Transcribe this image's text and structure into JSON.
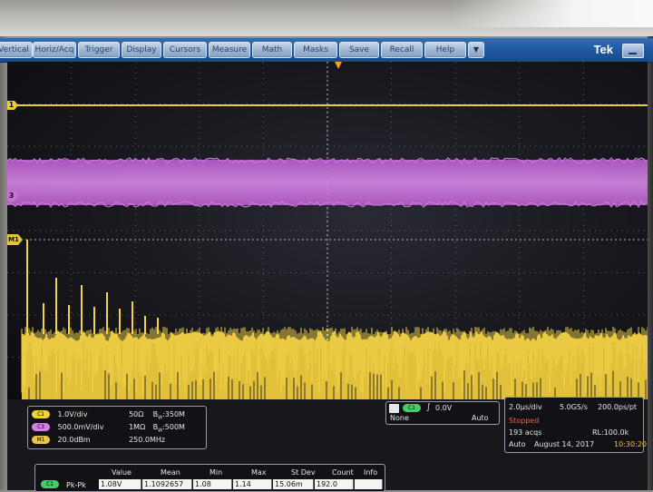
{
  "menu": {
    "items": [
      "Vertical",
      "Horiz/Acq",
      "Trigger",
      "Display",
      "Cursors",
      "Measure",
      "Math",
      "Masks",
      "Save",
      "Recall",
      "Help"
    ],
    "dropdown": "▼",
    "brand": "Tek"
  },
  "channels": [
    {
      "badge": "C1",
      "scale": "1.0V/div",
      "impedance": "50Ω",
      "bw_prefix": "B",
      "bw_sub": "W",
      "bw": ":350M",
      "color": "#f2d23c"
    },
    {
      "badge": "C3",
      "scale": "500.0mV/div",
      "impedance": "1MΩ",
      "bw_prefix": "B",
      "bw_sub": "W",
      "bw": ":500M",
      "color": "#d57ee6"
    },
    {
      "badge": "M1",
      "scale": "20.0dBm",
      "impedance": "250.0MHz",
      "color": "#e8c44a"
    }
  ],
  "markers": {
    "ch1": "1",
    "ch3": "3",
    "math": "M1"
  },
  "trigger": {
    "badge": "C1",
    "slope": "∫",
    "level": "0.0V",
    "source": "None",
    "mode": "Auto"
  },
  "acquisition": {
    "timebase": "2.0µs/div",
    "rate": "5.0GS/s",
    "resolution": "200.0ps/pt",
    "state": "Stopped",
    "acqs": "193 acqs",
    "record_length": "RL:100.0k",
    "mode": "Auto",
    "date": "August 14, 2017",
    "time": "10:30:20"
  },
  "measurements": {
    "headers": [
      "Value",
      "Mean",
      "Min",
      "Max",
      "St Dev",
      "Count",
      "Info"
    ],
    "rows": [
      {
        "badge": "C1",
        "name": "Pk-Pk",
        "value": "1.08V",
        "mean": "1.1092657",
        "min": "1.08",
        "max": "1.14",
        "stdev": "15.06m",
        "count": "192.0",
        "info": ""
      }
    ]
  },
  "colors": {
    "ch1": "#f2d23c",
    "ch3": "#c86fd8",
    "math": "#e6c23a",
    "menubar": "#1f56a0"
  }
}
